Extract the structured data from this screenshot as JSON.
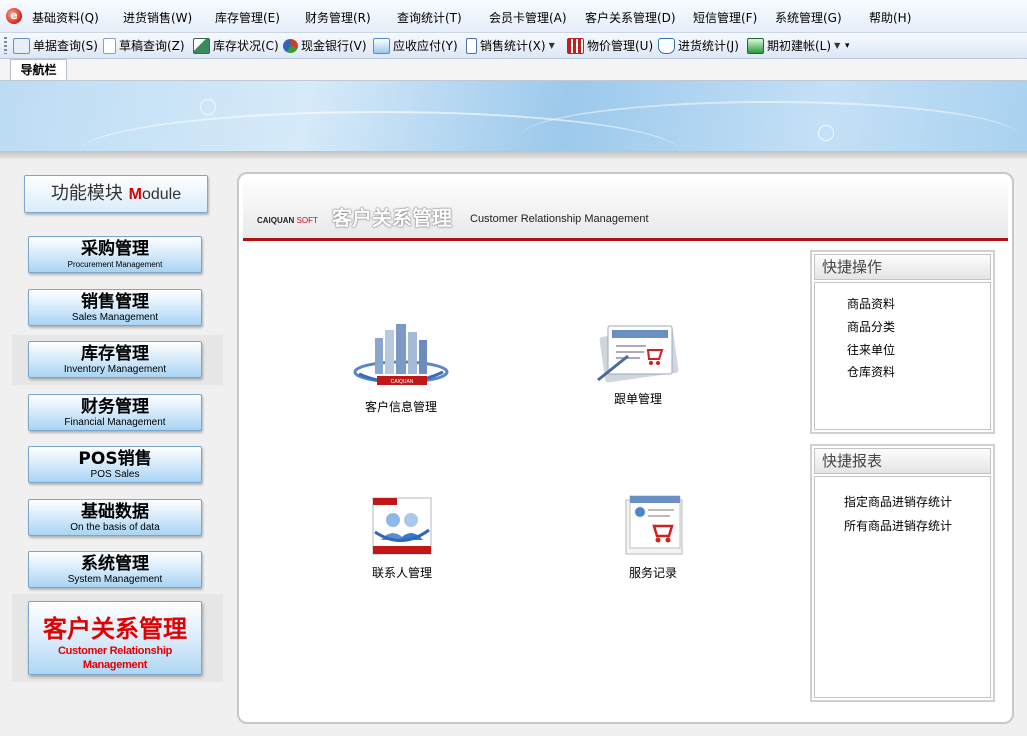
{
  "menubar": {
    "items": [
      "基础资料(Q)",
      "进货销售(W)",
      "库存管理(E)",
      "财务管理(R)",
      "查询统计(T)",
      "会员卡管理(A)",
      "客户关系管理(D)",
      "短信管理(F)",
      "系统管理(G)",
      "帮助(H)"
    ]
  },
  "toolbar": {
    "items": [
      {
        "label": "单据查询(S)",
        "icon": "document-list-icon",
        "color": "#6a8fc2"
      },
      {
        "label": "草稿查询(Z)",
        "icon": "draft-icon",
        "color": "#8aa0b8"
      },
      {
        "label": "库存状况(C)",
        "icon": "stock-icon",
        "color": "#3a8a5a"
      },
      {
        "label": "现金银行(V)",
        "icon": "cash-bank-icon",
        "color": "#d04020"
      },
      {
        "label": "应收应付(Y)",
        "icon": "receivable-icon",
        "color": "#4a90d0"
      },
      {
        "label": "销售统计(X)",
        "icon": "sales-stats-icon",
        "color": "#5070a0"
      },
      {
        "label": "物价管理(U)",
        "icon": "price-grid-icon",
        "color": "#c02020"
      },
      {
        "label": "进货统计(J)",
        "icon": "purchase-stats-icon",
        "color": "#3070b0"
      },
      {
        "label": "期初建帐(L)",
        "icon": "opening-account-icon",
        "color": "#2a9a3a"
      }
    ],
    "overflow": "▾"
  },
  "nav_tab": {
    "label": "导航栏"
  },
  "module_panel": {
    "header_zh": "功能模块",
    "header_m": "M",
    "header_rest": "odule",
    "modules": [
      {
        "zh": "采购管理",
        "en": "Procurement Management"
      },
      {
        "zh": "销售管理",
        "en": "Sales Management"
      },
      {
        "zh": "库存管理",
        "en": "Inventory Management"
      },
      {
        "zh": "财务管理",
        "en": "Financial Management"
      },
      {
        "zh": "POS销售",
        "en": "POS Sales"
      },
      {
        "zh": "基础数据",
        "en": "On the basis of data"
      },
      {
        "zh": "系统管理",
        "en": "System Management"
      }
    ],
    "active": {
      "zh": "客户关系管理",
      "en": "Customer Relationship Management"
    }
  },
  "main": {
    "brand": "CAIQUAN",
    "brand_soft": "SOFT",
    "title_zh": "客户关系管理",
    "title_en": "Customer Relationship Management",
    "functions": [
      {
        "label": "客户信息管理",
        "icon": "customer-info-icon"
      },
      {
        "label": "跟单管理",
        "icon": "order-tracking-icon"
      },
      {
        "label": "联系人管理",
        "icon": "contacts-icon"
      },
      {
        "label": "服务记录",
        "icon": "service-record-icon"
      }
    ],
    "icon_brand": "CAIQUAN"
  },
  "quick_ops": {
    "title": "快捷操作",
    "links": [
      "商品资料",
      "商品分类",
      "往来单位",
      "仓库资料"
    ]
  },
  "quick_reports": {
    "title": "快捷报表",
    "links": [
      "指定商品进销存统计",
      "所有商品进销存统计"
    ]
  },
  "colors": {
    "accent_red": "#d80000",
    "header_rule": "#b01010",
    "button_blue": "#a9d4f4"
  }
}
